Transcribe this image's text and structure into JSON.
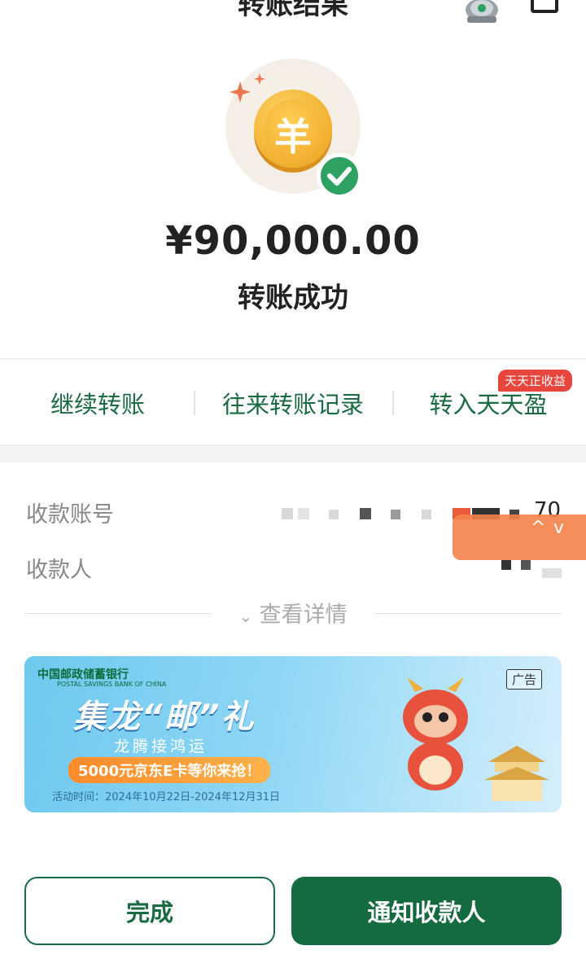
{
  "header": {
    "title": "转账结果"
  },
  "result": {
    "coin_glyph": "羊",
    "amount": "¥90,000.00",
    "status": "转账成功"
  },
  "actions": {
    "continue": "继续转账",
    "history": "往来转账记录",
    "transfer_in": "转入天天盈",
    "promo_badge": "天天正收益"
  },
  "details": {
    "account_label": "收款账号",
    "account_tail": "70",
    "payee_label": "收款人",
    "view_details": "查看详情"
  },
  "banner": {
    "bank_name": "中国邮政储蓄银行",
    "bank_name_en": "POSTAL SAVINGS BANK OF CHINA",
    "ad_tag": "广告",
    "title": "集龙“邮”礼",
    "subtitle": "龙腾接鸿运",
    "promo": "5000元京东E卡等你来抢！",
    "date": "活动时间：2024年10月22日-2024年12月31日"
  },
  "buttons": {
    "done": "完成",
    "notify": "通知收款人"
  },
  "colors": {
    "brand_green": "#156b40",
    "success_green": "#2fa263",
    "coin_gold": "#f3b533",
    "badge_red": "#e8453c"
  },
  "icons": [
    "robot-avatar-icon",
    "share-icon",
    "coin-icon",
    "check-icon",
    "sparkle-icon",
    "chevron-down-icon"
  ]
}
